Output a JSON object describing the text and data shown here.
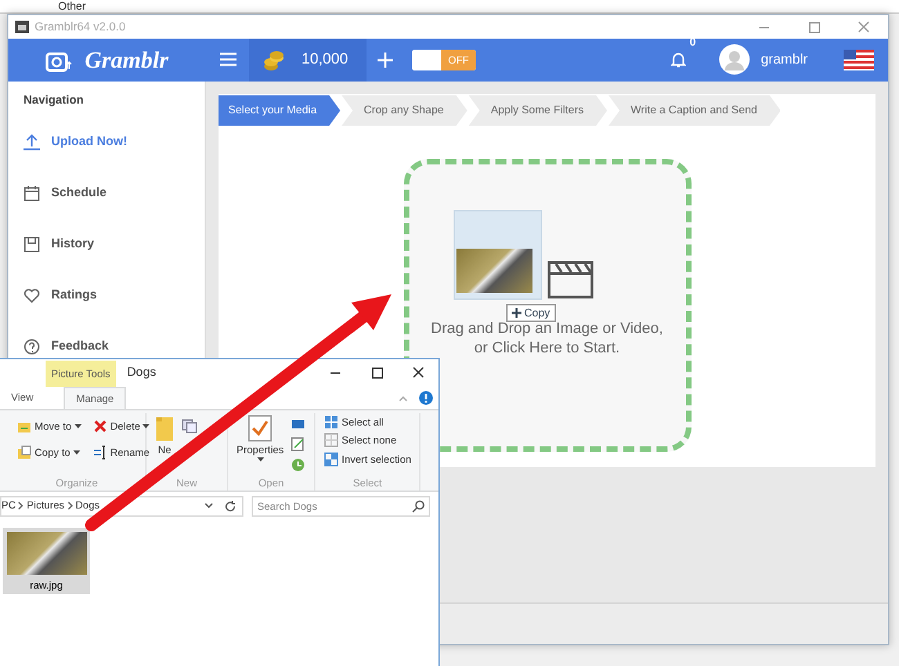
{
  "background_window": {
    "title": "Other"
  },
  "app": {
    "title": "Gramblr64 v2.0.0",
    "brand": "Gramblr",
    "coins": "10,000",
    "toggle": {
      "label": "OFF",
      "on": false
    },
    "notifications": "0",
    "username": "gramblr",
    "navigation": {
      "heading": "Navigation",
      "items": [
        {
          "label": "Upload Now!",
          "selected": true
        },
        {
          "label": "Schedule",
          "selected": false
        },
        {
          "label": "History",
          "selected": false
        },
        {
          "label": "Ratings",
          "selected": false
        },
        {
          "label": "Feedback",
          "selected": false
        }
      ]
    },
    "steps": [
      {
        "label": "Select your Media",
        "selected": true
      },
      {
        "label": "Crop any Shape",
        "selected": false
      },
      {
        "label": "Apply Some Filters",
        "selected": false
      },
      {
        "label": "Write a Caption and Send",
        "selected": false
      }
    ],
    "dropzone": {
      "lines": [
        "Drag and Drop an Image or Video,",
        "or Click Here to Start."
      ]
    },
    "drag_tooltip": "Copy"
  },
  "explorer": {
    "context_tab": "Picture Tools",
    "title": "Dogs",
    "tabs": [
      {
        "label": "View",
        "selected": false
      },
      {
        "label": "Manage",
        "selected": true
      }
    ],
    "ribbon": [
      {
        "label": "Organize",
        "kind": "grid",
        "commands": [
          {
            "label": "Move to",
            "dropdown": true
          },
          {
            "label": "Delete",
            "dropdown": true
          },
          {
            "label": "Copy to",
            "dropdown": true
          },
          {
            "label": "Rename",
            "dropdown": false
          }
        ]
      },
      {
        "label": "New",
        "kind": "large",
        "commands": [
          {
            "label": "Ne",
            "dropdown": false
          }
        ]
      },
      {
        "label": "Open",
        "kind": "large",
        "commands": [
          {
            "label": "Properties",
            "dropdown": true
          }
        ]
      },
      {
        "label": "Select",
        "kind": "list",
        "commands": [
          {
            "label": "Select all",
            "dropdown": false
          },
          {
            "label": "Select none",
            "dropdown": false
          },
          {
            "label": "Invert selection",
            "dropdown": false
          }
        ]
      }
    ],
    "address": [
      "PC",
      "Pictures",
      "Dogs"
    ],
    "search": {
      "placeholder": "Search Dogs"
    },
    "files": [
      {
        "name": "raw.jpg",
        "selected": true
      }
    ]
  }
}
